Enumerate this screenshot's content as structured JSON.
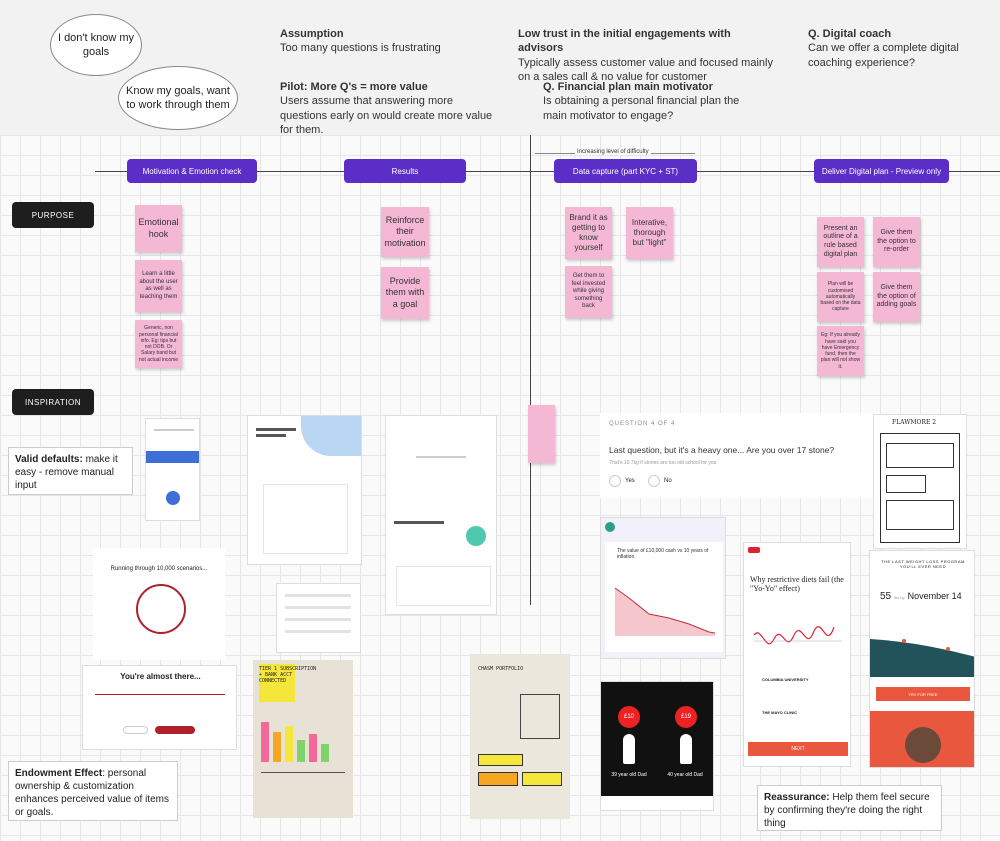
{
  "bubbles": {
    "b1": "I don't know my goals",
    "b2": "Know my goals, want to work through them"
  },
  "notes": {
    "assumption": {
      "title": "Assumption",
      "body": "Too many questions is frustrating"
    },
    "pilot": {
      "title": "Pilot: More Q's = more value",
      "body": "Users assume that answering more questions early on would create more value for them."
    },
    "lowtrust": {
      "title": "Low trust in the initial engagements with advisors",
      "body": "Typically assess customer value and focused mainly on a sales call & no value for customer"
    },
    "finplan": {
      "title": "Q. Financial plan main motivator",
      "body": "Is obtaining a personal financial plan the main motivator to engage?"
    },
    "digital": {
      "title": "Q. Digital coach",
      "body": "Can we offer a complete digital coaching experience?"
    }
  },
  "stages": [
    "Motivation & Emotion check",
    "Results",
    "Data capture (part KYC + ST)",
    "Deliver Digital plan - Preview only"
  ],
  "difficulty_label": "Increasing level of difficulty",
  "row_tags": {
    "purpose": "PURPOSE",
    "inspiration": "INSPIRATION"
  },
  "stickies": {
    "s1": "Emotional hook",
    "s2": "Learn a little about the user as well as teaching them",
    "s3": "Generic, non personal financial info. Eg: tips but not DOB. Or Salary band but not actual income",
    "s4": "Reinforce their motivation",
    "s5": "Provide them with a goal",
    "s6": "Brand it as getting to know yourself",
    "s7": "Interative, thorough but \"light\"",
    "s8": "Get them to feel invested while giving something back",
    "s9": "Present an outline of a rule based digital plan",
    "s10": "Give them the option to re-order",
    "s11": "Plan will be customised automatically based on the data capture",
    "s12": "Give them the option of adding goals",
    "s13": "Eg: If you already have said you have Emergency fund, then the plan will not show it."
  },
  "callouts": {
    "valid": {
      "bold": "Valid defaults:",
      "text": " make it easy - remove manual input"
    },
    "endowment": {
      "bold": "Endowment Effect",
      "text": ": personal ownership & customization enhances perceived value of items or goals."
    },
    "reassurance": {
      "bold": "Reassurance:",
      "text": " Help them feel secure by confirming they're doing the right thing"
    }
  },
  "shots": {
    "question_label": "QUESTION 4 OF 4",
    "question": "Last question, but it's a heavy one... Are you over 17 stone?",
    "question_sub": "That's 10.7kg if stones are too old school for you",
    "yes": "Yes",
    "no": "No",
    "running": "Running through 10,000 scenarios...",
    "almost": "You're almost there...",
    "value_title": "The value of £10,000 cash vs 10 years of inflation.",
    "yoyo": "Why restrictive diets fail (the \"Yo-Yo\" effect)",
    "weight_loss": "THE LAST WEIGHT LOSS PROGRAM YOU'LL EVER NEED",
    "lbs": "55",
    "lbs_unit": "lbs by",
    "date": "November 14",
    "try_free": "TRY FOR FREE",
    "dad1_price": "£10",
    "dad2_price": "£19",
    "dad1": "39 year old Dad",
    "dad2": "40 year old Dad",
    "next": "NEXT",
    "sketch1": "TIER 1 SUBSCRIPTION + BANK ACCT CONNECTED",
    "sketch2": "CHASM PORTFOLIO",
    "wireframe": "FLAWMORE 2",
    "columbia": "COLUMBIA UNIVERSITY",
    "mayo": "THE MAYO CLINIC"
  }
}
